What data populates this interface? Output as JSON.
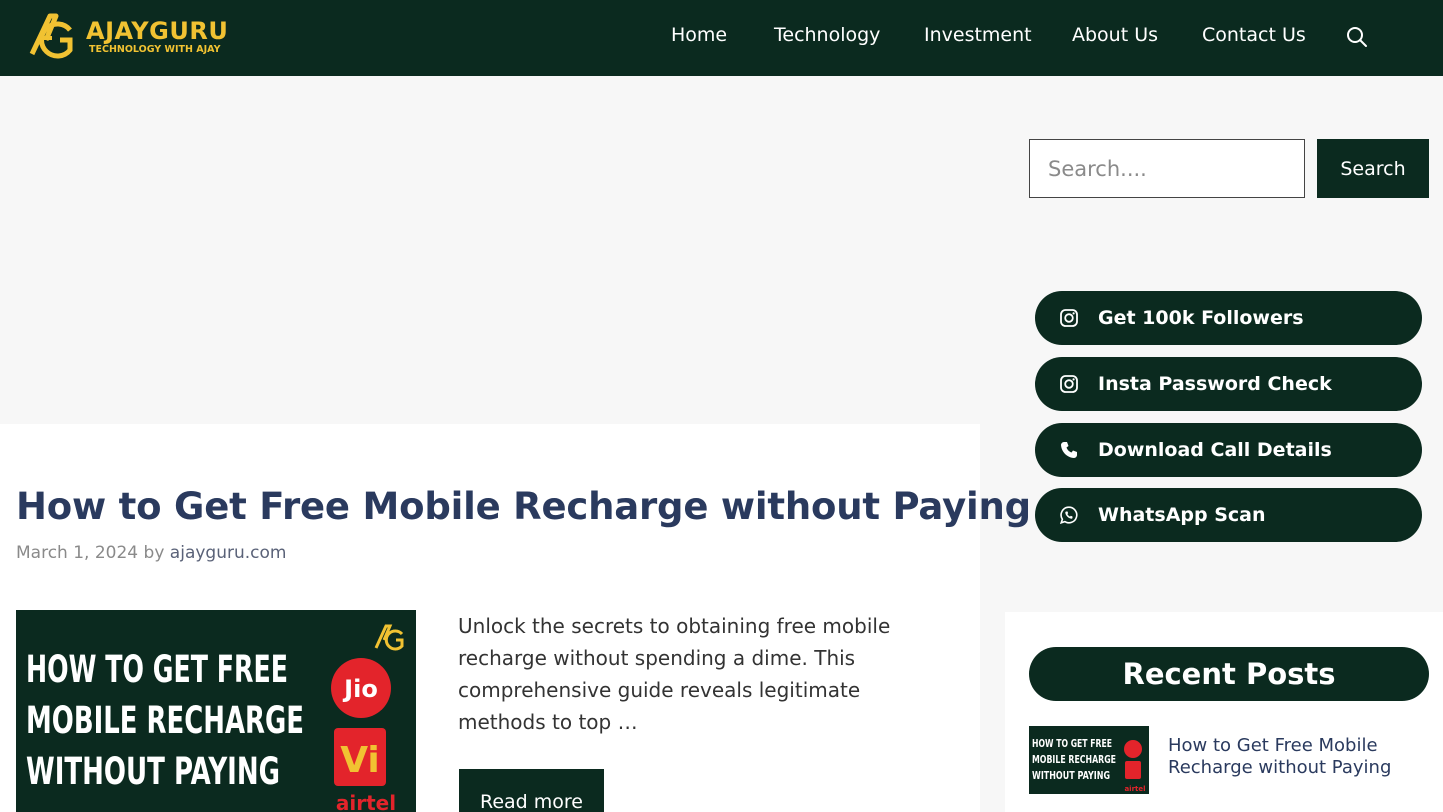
{
  "header": {
    "logo_name": "AJAYGURU",
    "logo_tagline": "TECHNOLOGY WITH AJAY",
    "nav": [
      "Home",
      "Technology",
      "Investment",
      "About Us",
      "Contact Us"
    ],
    "search_icon": "search-icon"
  },
  "colors": {
    "brand_dark": "#0b2a1f",
    "logo_gold": "#f1c232",
    "title_blue": "#2a3a5e"
  },
  "article": {
    "title": "How to Get Free Mobile Recharge without Paying",
    "date": "March 1, 2024",
    "by": "by",
    "author": "ajayguru.com",
    "excerpt": "Unlock the secrets to obtaining free mobile recharge without spending a dime. This comprehensive guide reveals legitimate methods to top …",
    "read_more": "Read more",
    "thumbnail": {
      "lines": [
        "HOW TO GET FREE",
        "MOBILE RECHARGE",
        "WITHOUT PAYING"
      ],
      "brand_jio": "Jio",
      "brand_vi": "Vi",
      "brand_airtel": "airtel"
    }
  },
  "sidebar": {
    "search": {
      "placeholder": "Search....",
      "button": "Search"
    },
    "links": [
      {
        "label": "Get 100k Followers",
        "icon": "instagram-icon"
      },
      {
        "label": "Insta Password Check",
        "icon": "instagram-icon"
      },
      {
        "label": "Download Call Details",
        "icon": "phone-icon"
      },
      {
        "label": "WhatsApp Scan",
        "icon": "whatsapp-icon"
      }
    ],
    "recent": {
      "heading": "Recent Posts",
      "posts": [
        {
          "title": "How to Get Free Mobile Recharge without Paying"
        }
      ]
    }
  }
}
